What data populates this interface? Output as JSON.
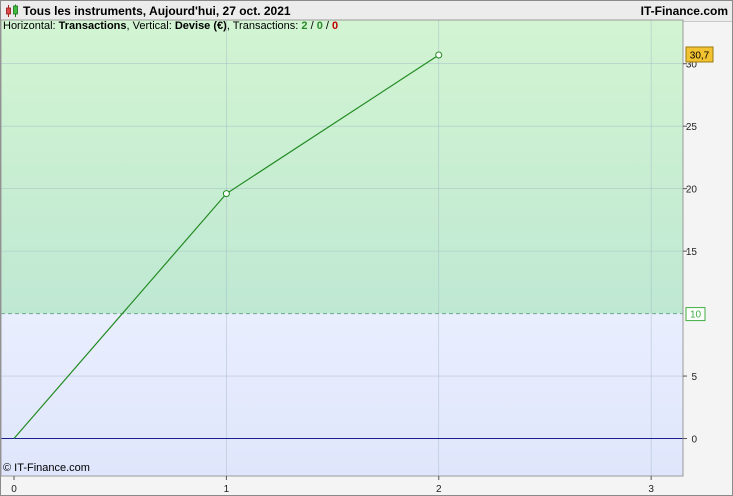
{
  "header": {
    "title": "Tous les instruments, Aujourd'hui, 27 oct. 2021",
    "brand": "IT-Finance.com"
  },
  "info": {
    "horizontal_label": "Horizontal:",
    "horizontal_value": "Transactions",
    "vertical_label": "Vertical:",
    "vertical_value": "Devise (€)",
    "transactions_label": "Transactions:",
    "count_positive": "2",
    "count_zero": "0",
    "count_negative": "0",
    "separator": "/"
  },
  "footer": {
    "copyright": "© IT-Finance.com"
  },
  "colors": {
    "zone_upper_top": "#d2f4d2",
    "zone_upper_bottom": "#bfe8d3",
    "zone_lower_top": "#e9eefe",
    "zone_lower_bottom": "#dfe6fb",
    "line": "#228b22",
    "zero_line": "#1e1e8c",
    "grid": "#9fb6c6",
    "current_badge": "#f2c230",
    "target_badge_text": "#3fae3f"
  },
  "chart_data": {
    "type": "line",
    "x": [
      0,
      1,
      2
    ],
    "values": [
      0,
      19.6,
      30.7
    ],
    "xlim": [
      0,
      3.15
    ],
    "ylim": [
      -3,
      33.5
    ],
    "x_ticks": [
      "0",
      "1",
      "2",
      "3"
    ],
    "y_ticks": [
      "0",
      "5",
      "10",
      "15",
      "20",
      "25",
      "30"
    ],
    "threshold": 10,
    "threshold_label": "10",
    "current_value_label": "30,7",
    "grid": true
  }
}
